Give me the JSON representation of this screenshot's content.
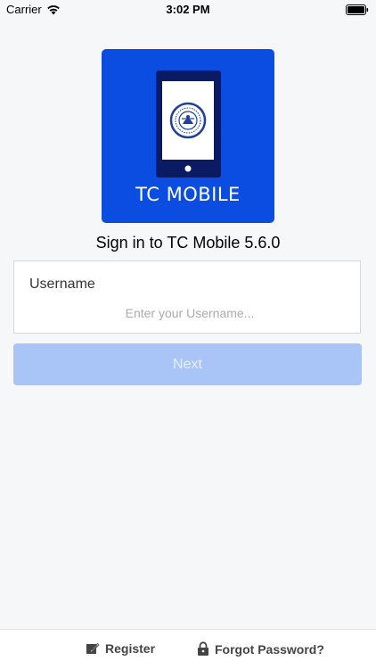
{
  "status_bar": {
    "carrier": "Carrier",
    "time": "3:02 PM"
  },
  "logo": {
    "text": "TC MOBILE",
    "background_color": "#0a4de0"
  },
  "signin": {
    "title": "Sign in to TC Mobile 5.6.0"
  },
  "username": {
    "label": "Username",
    "placeholder": "Enter your Username...",
    "value": ""
  },
  "next_button": {
    "label": "Next",
    "enabled": false,
    "color": "#a9c4f7"
  },
  "footer": {
    "register_label": "Register",
    "register_icon": "edit-icon",
    "forgot_label": "Forgot Password?",
    "forgot_icon": "lock-icon"
  }
}
